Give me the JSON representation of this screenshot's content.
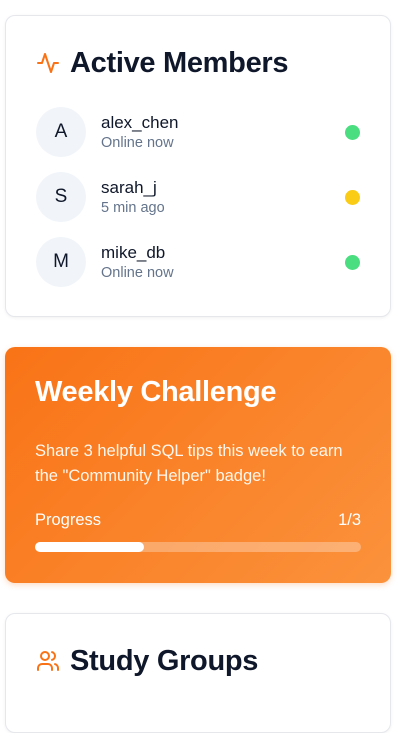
{
  "members_card": {
    "title": "Active Members",
    "icon": "activity-icon",
    "members": [
      {
        "initial": "A",
        "name": "alex_chen",
        "status": "Online now",
        "status_color": "#4ade80"
      },
      {
        "initial": "S",
        "name": "sarah_j",
        "status": "5 min ago",
        "status_color": "#facc15"
      },
      {
        "initial": "M",
        "name": "mike_db",
        "status": "Online now",
        "status_color": "#4ade80"
      }
    ]
  },
  "challenge_card": {
    "title": "Weekly Challenge",
    "description": "Share 3 helpful SQL tips this week to earn the \"Community Helper\" badge!",
    "progress_label": "Progress",
    "progress_text": "1/3",
    "progress_fraction": 0.333,
    "gradient_start": "#f97316",
    "gradient_end": "#fb923c"
  },
  "groups_card": {
    "title": "Study Groups",
    "icon": "users-icon"
  },
  "colors": {
    "accent": "#f97316",
    "text_primary": "#0f172a",
    "text_muted": "#64748b"
  }
}
